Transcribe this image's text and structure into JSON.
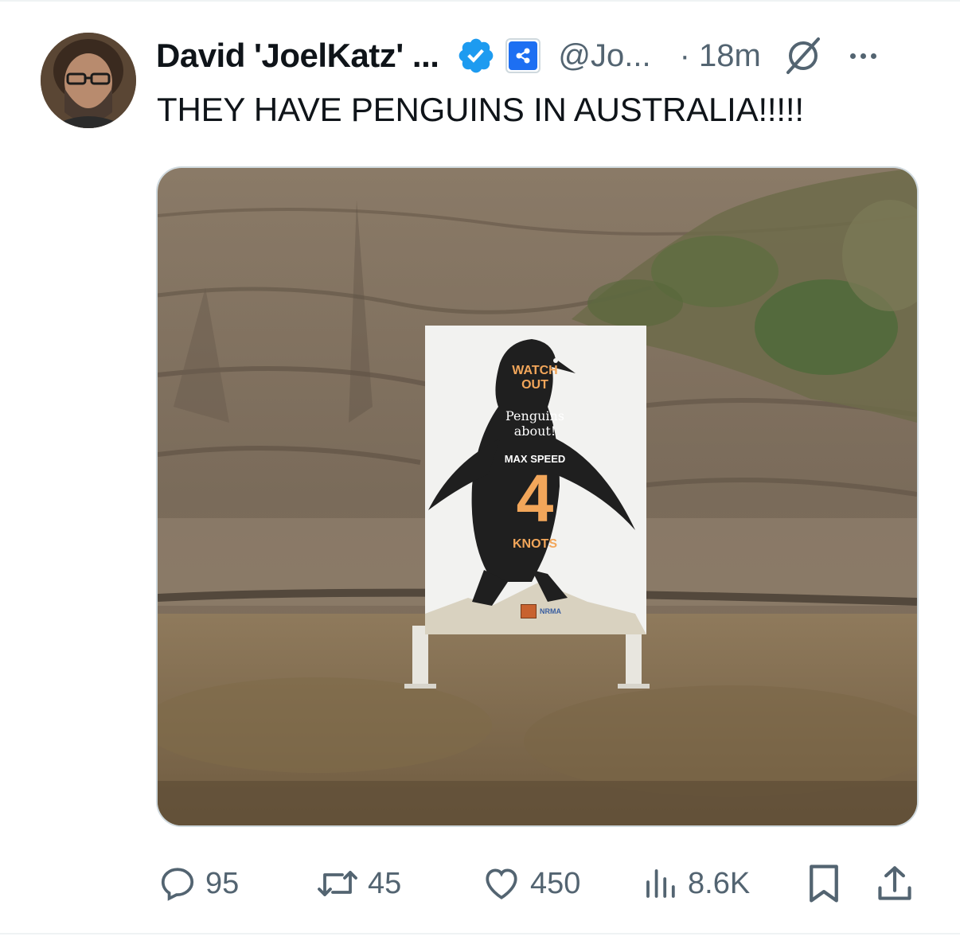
{
  "tweet": {
    "author": {
      "display_name": "David 'JoelKatz' ...",
      "handle": "@Jo...",
      "verified": true,
      "avatar_icon": "user-avatar"
    },
    "timestamp": "· 18m",
    "text": "THEY HAVE PENGUINS IN AUSTRALIA!!!!!",
    "image": {
      "sign": {
        "line1": "WATCH",
        "line2": "OUT",
        "line3": "Penguins",
        "line4": "about!",
        "line5": "MAX SPEED",
        "speed": "4",
        "unit": "KNOTS",
        "logo": "NRMA"
      }
    },
    "actions": {
      "replies": "95",
      "reposts": "45",
      "likes": "450",
      "views": "8.6K"
    },
    "icons": {
      "verified": "verified-badge-icon",
      "affiliate": "affiliate-badge-icon",
      "grok": "grok-icon",
      "more": "more-icon",
      "reply": "reply-icon",
      "repost": "repost-icon",
      "like": "heart-icon",
      "views": "views-icon",
      "bookmark": "bookmark-icon",
      "share": "share-icon"
    },
    "colors": {
      "verified_blue": "#1d9bf0",
      "affiliate_blue": "#1d6ff2",
      "text_primary": "#0f1419",
      "text_secondary": "#536471",
      "sign_orange": "#f2a65a"
    }
  }
}
